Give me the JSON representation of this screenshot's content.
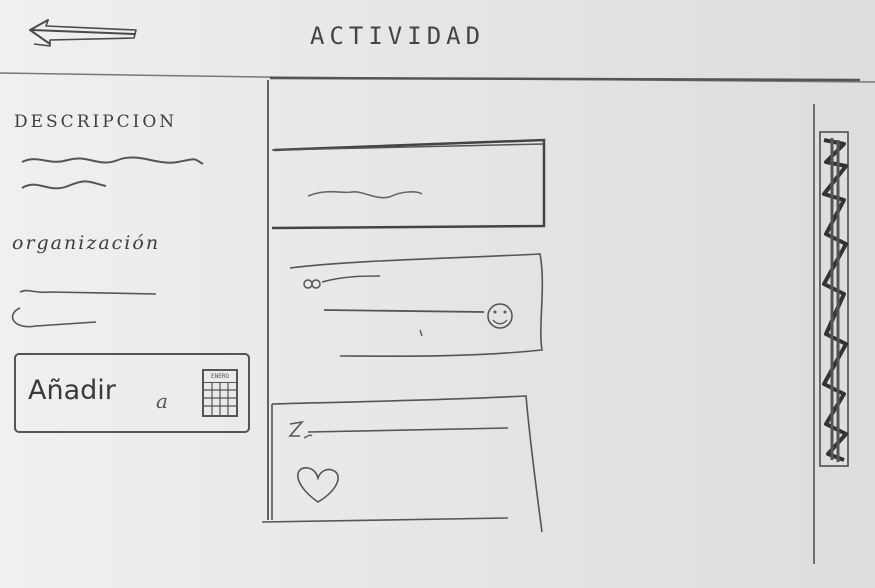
{
  "header": {
    "title": "ACTIVIDAD",
    "back_icon": "back-arrow-icon"
  },
  "sidebar": {
    "description_label": "DESCRIPCION",
    "organization_label": "organización",
    "add_button": {
      "label": "Añadir",
      "connector": "a",
      "icon": "calendar-icon",
      "icon_text": "ENERO"
    }
  },
  "feed": {
    "cards": [
      {
        "type": "text-post",
        "icon": null
      },
      {
        "type": "comment-post",
        "icon": "smiley-icon",
        "avatar": "avatar-icon"
      },
      {
        "type": "liked-post",
        "icon": "heart-icon",
        "avatar": "z-icon"
      }
    ]
  },
  "colors": {
    "paper": "#ebebe9",
    "pencil": "#444444"
  }
}
